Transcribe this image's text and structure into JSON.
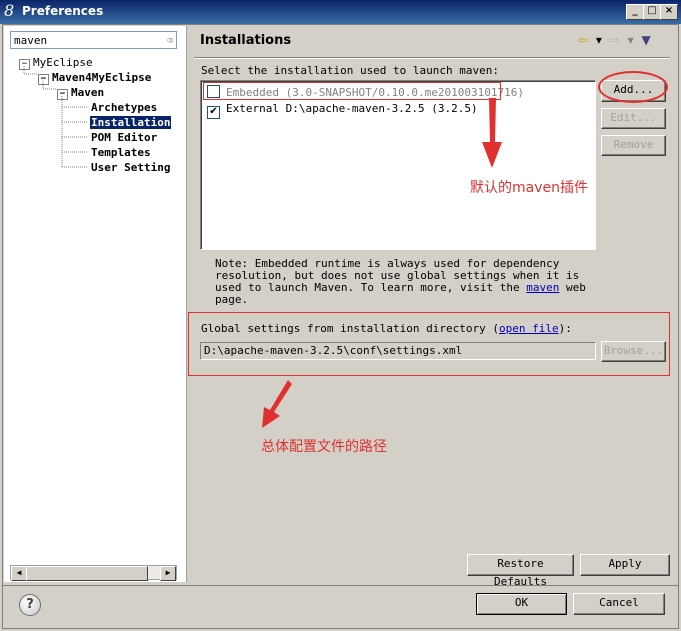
{
  "window": {
    "title": "Preferences",
    "title_icon_glyph": "8",
    "minimize_glyph": "_",
    "maximize_glyph": "□",
    "close_glyph": "×"
  },
  "sidebar": {
    "filter_value": "maven",
    "tree": [
      {
        "label": "MyEclipse",
        "expander": "−"
      },
      {
        "label": "Maven4MyEclipse",
        "expander": "−"
      },
      {
        "label": "Maven",
        "expander": "−"
      },
      {
        "label": "Archetypes"
      },
      {
        "label": "Installation",
        "selected": true
      },
      {
        "label": "POM Editor"
      },
      {
        "label": "Templates"
      },
      {
        "label": "User Setting"
      }
    ],
    "scroll_left": "◀",
    "scroll_right": "▶"
  },
  "page": {
    "title": "Installations",
    "nav_back": "⇦",
    "nav_dropdown": "▾",
    "nav_forward": "⇨",
    "nav_menu": "▼",
    "select_label": "Select the installation used to launch maven:",
    "installations": [
      {
        "label": "Embedded (3.0-SNAPSHOT/0.10.0.me201003101716)",
        "checked": false,
        "check_glyph": "",
        "disabled": true
      },
      {
        "label": "External D:\\apache-maven-3.2.5 (3.2.5)",
        "checked": true,
        "check_glyph": "✔",
        "disabled": false
      }
    ],
    "buttons": {
      "add": "Add...",
      "edit": "Edit...",
      "remove": "Remove",
      "browse": "Browse...",
      "restore_defaults": "Restore Defaults",
      "apply": "Apply"
    },
    "note_prefix": "Note: Embedded runtime is always used for dependency resolution, but does not use global settings when it is used to launch Maven. To learn more, visit the ",
    "note_link": "maven",
    "note_suffix": " web page.",
    "global_settings_prefix": "Global settings from installation directory (",
    "global_settings_link": "open file",
    "global_settings_suffix": "):",
    "global_settings_path": "D:\\apache-maven-3.2.5\\conf\\settings.xml"
  },
  "annotations": {
    "default_plugin": "默认的maven插件",
    "config_path": "总体配置文件的路径",
    "color": "#e03030"
  },
  "dialog": {
    "help_glyph": "?",
    "ok": "OK",
    "cancel": "Cancel"
  }
}
